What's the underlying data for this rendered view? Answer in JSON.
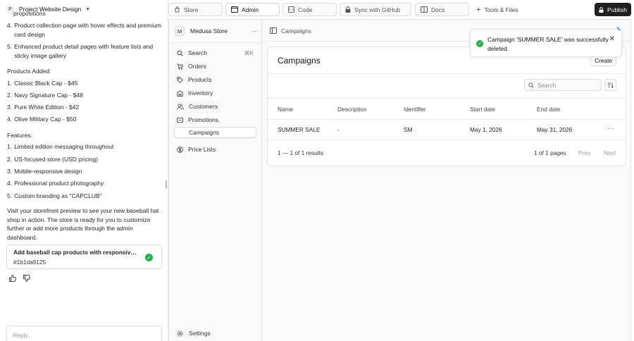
{
  "left": {
    "project_avatar": "P",
    "project_title": "Project Website Design",
    "chat": {
      "cut_line": "propositions",
      "list1": [
        {
          "n": "4.",
          "text": "Product collection page with hover effects and premium card design"
        },
        {
          "n": "5.",
          "text": "Enhanced product detail pages with feature lists and sticky image gallery"
        }
      ],
      "products_heading": "Products Added:",
      "products": [
        {
          "n": "1.",
          "text": "Classic Black Cap - $45"
        },
        {
          "n": "2.",
          "text": "Navy Signature Cap - $48"
        },
        {
          "n": "3.",
          "text": "Pure White Edition - $42"
        },
        {
          "n": "4.",
          "text": "Olive Military Cap - $50"
        }
      ],
      "features_heading": "Features:",
      "features": [
        {
          "n": "1.",
          "text": "Limited edition messaging throughout"
        },
        {
          "n": "2.",
          "text": "US-focused store (USD pricing)"
        },
        {
          "n": "3.",
          "text": "Mobile-responsive design"
        },
        {
          "n": "4.",
          "text": "Professional product photography"
        },
        {
          "n": "5.",
          "text": "Custom branding as \"CAPCLUB\""
        }
      ],
      "closing": "Visit your storefront preview to see your new baseball hat shop in action. The store is ready for you to customize further or add more products through the admin dashboard."
    },
    "commit": {
      "title": "Add baseball cap products with responsive grid",
      "id": "#1b1da9125"
    },
    "reply_placeholder": "Reply..."
  },
  "toolbar": {
    "tabs": [
      {
        "label": "Store",
        "icon": "store-icon"
      },
      {
        "label": "Admin",
        "icon": "admin-icon"
      },
      {
        "label": "Code",
        "icon": "code-icon"
      },
      {
        "label": "Sync with GitHub",
        "icon": "lock-icon"
      },
      {
        "label": "Docs",
        "icon": "docs-icon"
      }
    ],
    "tools_label": "Tools & Files",
    "publish_label": "Publish"
  },
  "admin": {
    "store_avatar": "M",
    "store_name": "Medusa Store",
    "nav": {
      "search": "Search",
      "search_kbd": "⌘K",
      "orders": "Orders",
      "products": "Products",
      "inventory": "Inventory",
      "customers": "Customers",
      "promotions": "Promotions",
      "campaigns": "Campaigns",
      "price_lists": "Price Lists",
      "settings": "Settings"
    },
    "breadcrumb": "Campaigns",
    "card": {
      "title": "Campaigns",
      "create_label": "Create",
      "search_placeholder": "Search",
      "columns": {
        "name": "Name",
        "description": "Description",
        "identifier": "Identifier",
        "start": "Start date",
        "end": "End date"
      },
      "row": {
        "name": "SUMMER SALE",
        "description": "-",
        "identifier": "SM",
        "start": "May 1, 2026",
        "end": "May 31, 2026"
      },
      "pagination": {
        "results": "1 — 1 of 1 results",
        "pages": "1 of 1 pages",
        "prev": "Prev",
        "next": "Next"
      }
    }
  },
  "toast": {
    "message": "Campaign 'SUMMER SALE' was successfully deleted."
  },
  "colors": {
    "success": "#22b14c",
    "publish_bg": "#1f1f1f",
    "accent": "#2563eb"
  }
}
